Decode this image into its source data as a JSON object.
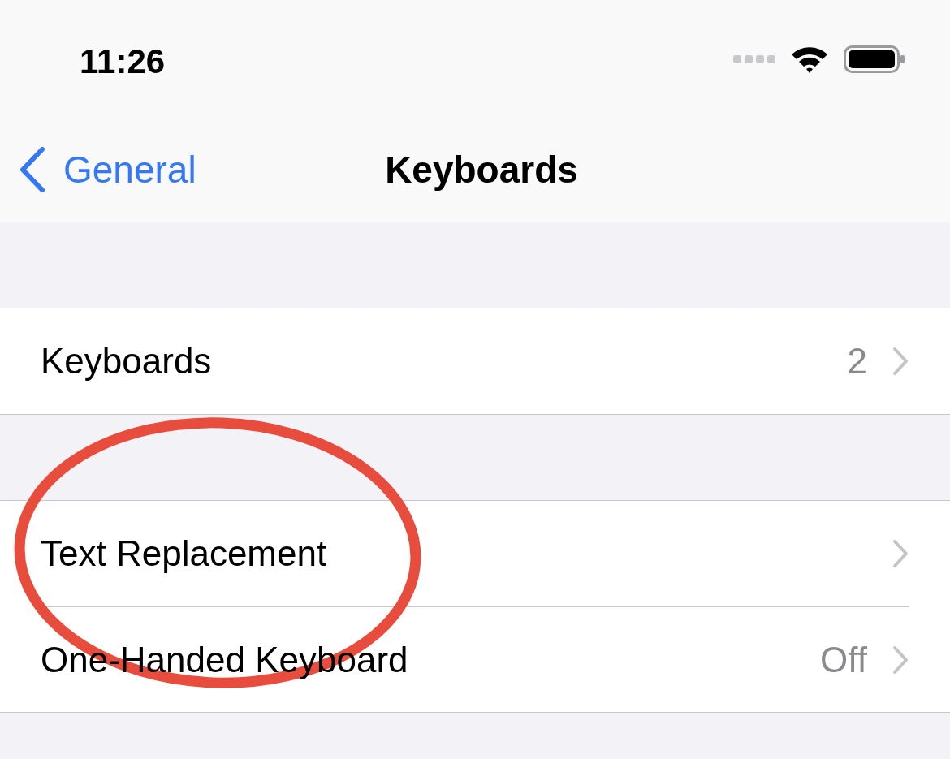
{
  "status_bar": {
    "time": "11:26"
  },
  "nav": {
    "back_label": "General",
    "title": "Keyboards"
  },
  "groups": [
    {
      "rows": [
        {
          "label": "Keyboards",
          "value": "2"
        }
      ]
    },
    {
      "rows": [
        {
          "label": "Text Replacement"
        },
        {
          "label": "One-Handed Keyboard",
          "value": "Off"
        }
      ]
    }
  ],
  "annotation": {
    "kind": "ellipse"
  }
}
